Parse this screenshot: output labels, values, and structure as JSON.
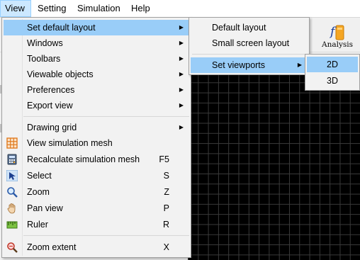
{
  "menubar": {
    "items": [
      {
        "label": "View"
      },
      {
        "label": "Setting"
      },
      {
        "label": "Simulation"
      },
      {
        "label": "Help"
      }
    ]
  },
  "toolbar": {
    "analysis_label": "Analysis",
    "analysis_icon": "function-icon"
  },
  "view_menu": {
    "items": [
      {
        "label": "Set default layout",
        "submenu": true
      },
      {
        "label": "Windows",
        "submenu": true
      },
      {
        "label": "Toolbars",
        "submenu": true
      },
      {
        "label": "Viewable objects",
        "submenu": true
      },
      {
        "label": "Preferences",
        "submenu": true
      },
      {
        "label": "Export view",
        "submenu": true
      },
      {
        "label": "Drawing grid",
        "submenu": true
      },
      {
        "label": "View simulation mesh",
        "icon": "mesh-grid-icon"
      },
      {
        "label": "Recalculate simulation mesh",
        "shortcut": "F5",
        "icon": "calculator-icon"
      },
      {
        "label": "Select",
        "shortcut": "S",
        "icon": "cursor-arrow-icon"
      },
      {
        "label": "Zoom",
        "shortcut": "Z",
        "icon": "magnifier-icon"
      },
      {
        "label": "Pan view",
        "shortcut": "P",
        "icon": "hand-icon"
      },
      {
        "label": "Ruler",
        "shortcut": "R",
        "icon": "ruler-icon"
      },
      {
        "label": "Zoom extent",
        "shortcut": "X",
        "icon": "zoom-extent-icon"
      }
    ]
  },
  "layout_menu": {
    "items": [
      {
        "label": "Default layout"
      },
      {
        "label": "Small screen layout"
      },
      {
        "label": "Set viewports",
        "submenu": true
      }
    ]
  },
  "viewport_menu": {
    "items": [
      {
        "label": "2D"
      },
      {
        "label": "3D"
      }
    ]
  },
  "colors": {
    "highlight": "#99cdf8",
    "menubar_active": "#cce8ff",
    "canvas": "#000000"
  }
}
